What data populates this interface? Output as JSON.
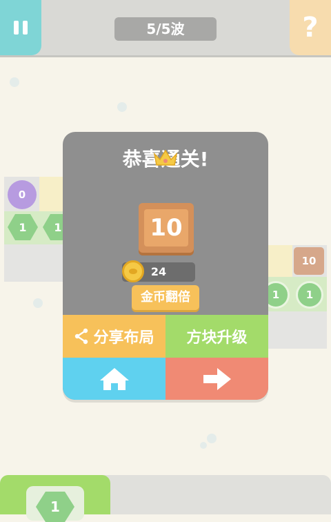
{
  "header": {
    "wave_text": "5/5波",
    "help_symbol": "?"
  },
  "dialog": {
    "title": "恭喜通关!",
    "level_value": "10",
    "coins": "24",
    "double_label": "金币翻倍",
    "share_label": "分享布局",
    "upgrade_label": "方块升级"
  },
  "board": {
    "purple_value": "0",
    "left_hex_1": "1",
    "left_hex_2": "1",
    "right_tile": "10",
    "right_bubble_1": "1",
    "right_bubble_2": "1",
    "bottom_hex": "1"
  },
  "colors": {
    "pause": "#7fd5d6",
    "help": "#f7dcae",
    "share": "#f7c15a",
    "upgrade": "#a3db6a",
    "home": "#5fd1ef",
    "next": "#f08a74",
    "level_tile": "#e9a76a",
    "coin": "#f5c945"
  },
  "icons": [
    "pause-icon",
    "help-icon",
    "crown-icon",
    "coin-icon",
    "share-icon",
    "home-icon",
    "arrow-right-icon"
  ]
}
